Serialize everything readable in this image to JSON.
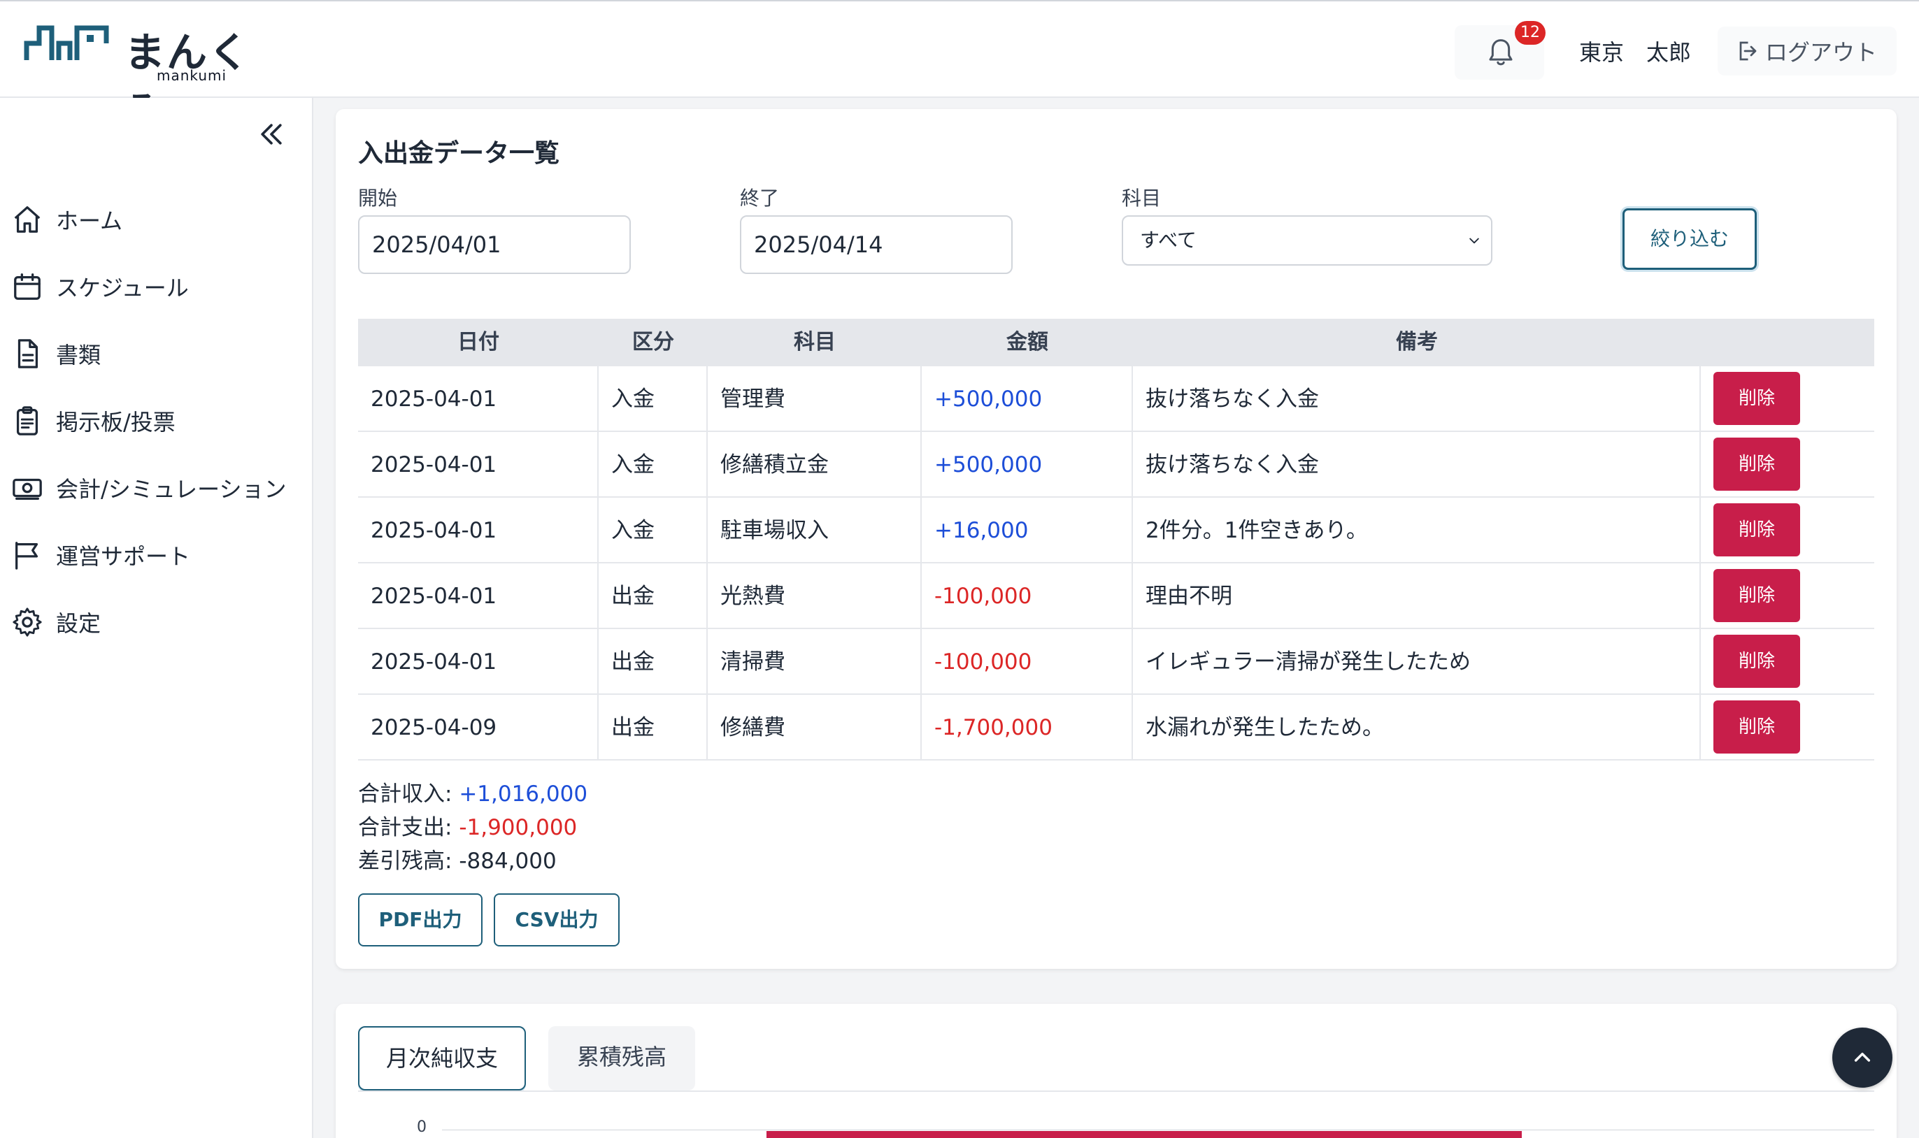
{
  "header": {
    "logo_text": "まんくみ",
    "logo_sub": "mankumi",
    "notification_count": "12",
    "user_name": "東京　太郎",
    "logout_label": "ログアウト"
  },
  "sidebar": {
    "items": [
      {
        "label": "ホーム",
        "icon": "home-icon"
      },
      {
        "label": "スケジュール",
        "icon": "calendar-icon"
      },
      {
        "label": "書類",
        "icon": "document-icon"
      },
      {
        "label": "掲示板/投票",
        "icon": "clipboard-icon"
      },
      {
        "label": "会計/シミュレーション",
        "icon": "money-icon"
      },
      {
        "label": "運営サポート",
        "icon": "flag-icon"
      },
      {
        "label": "設定",
        "icon": "gear-icon"
      }
    ]
  },
  "main": {
    "title": "入出金データ一覧",
    "filters": {
      "start_label": "開始",
      "start_value": "2025/04/01",
      "end_label": "終了",
      "end_value": "2025/04/14",
      "category_label": "科目",
      "category_value": "すべて",
      "filter_button": "絞り込む"
    },
    "table": {
      "headers": [
        "日付",
        "区分",
        "科目",
        "金額",
        "備考"
      ],
      "rows": [
        {
          "date": "2025-04-01",
          "type": "入金",
          "category": "管理費",
          "amount": "+500,000",
          "note": "抜け落ちなく入金",
          "action": "削除"
        },
        {
          "date": "2025-04-01",
          "type": "入金",
          "category": "修繕積立金",
          "amount": "+500,000",
          "note": "抜け落ちなく入金",
          "action": "削除"
        },
        {
          "date": "2025-04-01",
          "type": "入金",
          "category": "駐車場収入",
          "amount": "+16,000",
          "note": "2件分。1件空きあり。",
          "action": "削除"
        },
        {
          "date": "2025-04-01",
          "type": "出金",
          "category": "光熱費",
          "amount": "-100,000",
          "note": "理由不明",
          "action": "削除"
        },
        {
          "date": "2025-04-01",
          "type": "出金",
          "category": "清掃費",
          "amount": "-100,000",
          "note": "イレギュラー清掃が発生したため",
          "action": "削除"
        },
        {
          "date": "2025-04-09",
          "type": "出金",
          "category": "修繕費",
          "amount": "-1,700,000",
          "note": "水漏れが発生したため。",
          "action": "削除"
        }
      ]
    },
    "summary": {
      "income_label": "合計収入:",
      "income_value": "+1,016,000",
      "expense_label": "合計支出:",
      "expense_value": "-1,900,000",
      "balance_label": "差引残高:",
      "balance_value": "-884,000"
    },
    "export": {
      "pdf_label": "PDF出力",
      "csv_label": "CSV出力"
    }
  },
  "chart_section": {
    "tabs": [
      {
        "label": "月次純収支",
        "active": true
      },
      {
        "label": "累積残高",
        "active": false
      }
    ],
    "axis_tick": "0"
  },
  "colors": {
    "accent": "#1e5f7a",
    "positive": "#1d4ed8",
    "negative": "#dc2626",
    "delete": "#c81e4a"
  }
}
